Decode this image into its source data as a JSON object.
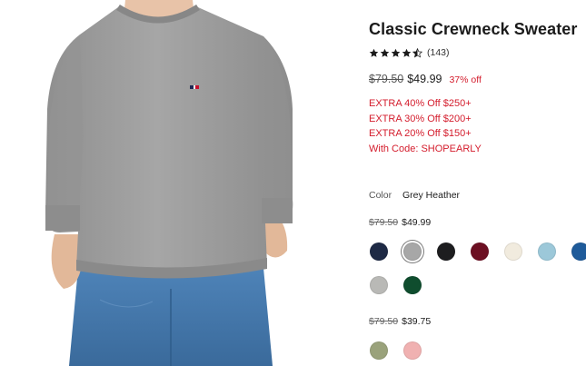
{
  "product": {
    "title": "Classic Crewneck Sweater",
    "rating_value": 4.5,
    "rating_count": "(143)",
    "price_old": "$79.50",
    "price_new": "$49.99",
    "discount": "37% off"
  },
  "promos": [
    "EXTRA 40% Off $250+",
    "EXTRA 30% Off $200+",
    "EXTRA 20% Off $150+",
    "With Code: SHOPEARLY"
  ],
  "color": {
    "label": "Color",
    "selected": "Grey Heather"
  },
  "price_groups": [
    {
      "price_old": "$79.50",
      "price_new": "$49.99",
      "rows": [
        [
          {
            "name": "navy",
            "hex": "#1e2a45"
          },
          {
            "name": "grey-heather",
            "hex": "#a7a7a7",
            "selected": true
          },
          {
            "name": "black",
            "hex": "#1d1d1f"
          },
          {
            "name": "burgundy",
            "hex": "#6c0f22"
          },
          {
            "name": "cream",
            "hex": "#f1ebde"
          },
          {
            "name": "light-blue",
            "hex": "#9cc8d9"
          },
          {
            "name": "blue",
            "hex": "#1f5b9a"
          }
        ],
        [
          {
            "name": "light-grey",
            "hex": "#b9b9b6"
          },
          {
            "name": "green",
            "hex": "#0f4d2e"
          }
        ]
      ]
    },
    {
      "price_old": "$79.50",
      "price_new": "$39.75",
      "rows": [
        [
          {
            "name": "olive",
            "hex": "#9aa27b"
          },
          {
            "name": "pink",
            "hex": "#f0b1b1"
          }
        ]
      ]
    }
  ],
  "colors": {
    "sale_red": "#d41c2c",
    "sweater_grey": "#9c9c9c",
    "jeans_blue": "#3f74a8"
  }
}
